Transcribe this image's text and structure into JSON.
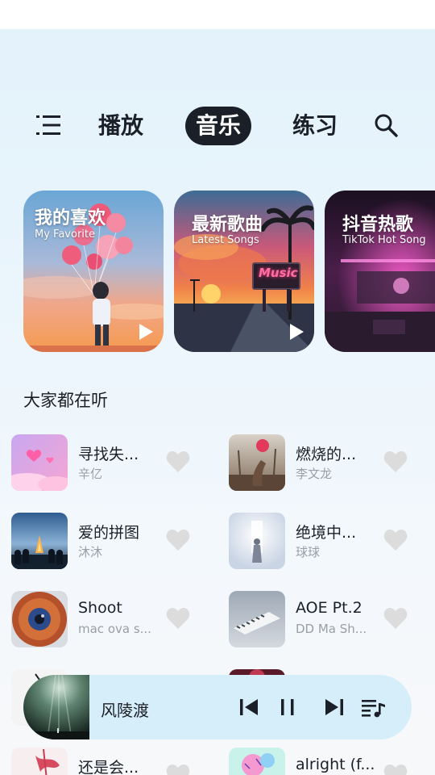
{
  "nav": {
    "tabs": [
      {
        "label": "播放"
      },
      {
        "label": "音乐",
        "active": true
      },
      {
        "label": "练习"
      }
    ],
    "menu_icon": "menu-icon",
    "search_icon": "search-icon"
  },
  "playlists": [
    {
      "title": "我的喜欢",
      "subtitle": "My Favorite"
    },
    {
      "title": "最新歌曲",
      "subtitle": "Latest Songs",
      "sign_text": "Music"
    },
    {
      "title": "抖音热歌",
      "subtitle": "TikTok Hot Song"
    }
  ],
  "section": {
    "title": "大家都在听"
  },
  "songs": [
    {
      "title": "寻找失...",
      "artist": "辛亿"
    },
    {
      "title": "燃烧的...",
      "artist": "李文龙"
    },
    {
      "title": "爱的拼图",
      "artist": "沐沐"
    },
    {
      "title": "绝境中...",
      "artist": "球球"
    },
    {
      "title": "Shoot",
      "artist": "mac ova s..."
    },
    {
      "title": "AOE Pt.2",
      "artist": "DD Ma Sh..."
    },
    {
      "title": "还是会...",
      "artist": ""
    },
    {
      "title": "alright (f...",
      "artist": ""
    }
  ],
  "player": {
    "title": "风陵渡",
    "state": "playing"
  },
  "colors": {
    "accent_dark": "#1b1f27",
    "player_bg": "#d6eefa",
    "heart": "#dcdcdc"
  }
}
